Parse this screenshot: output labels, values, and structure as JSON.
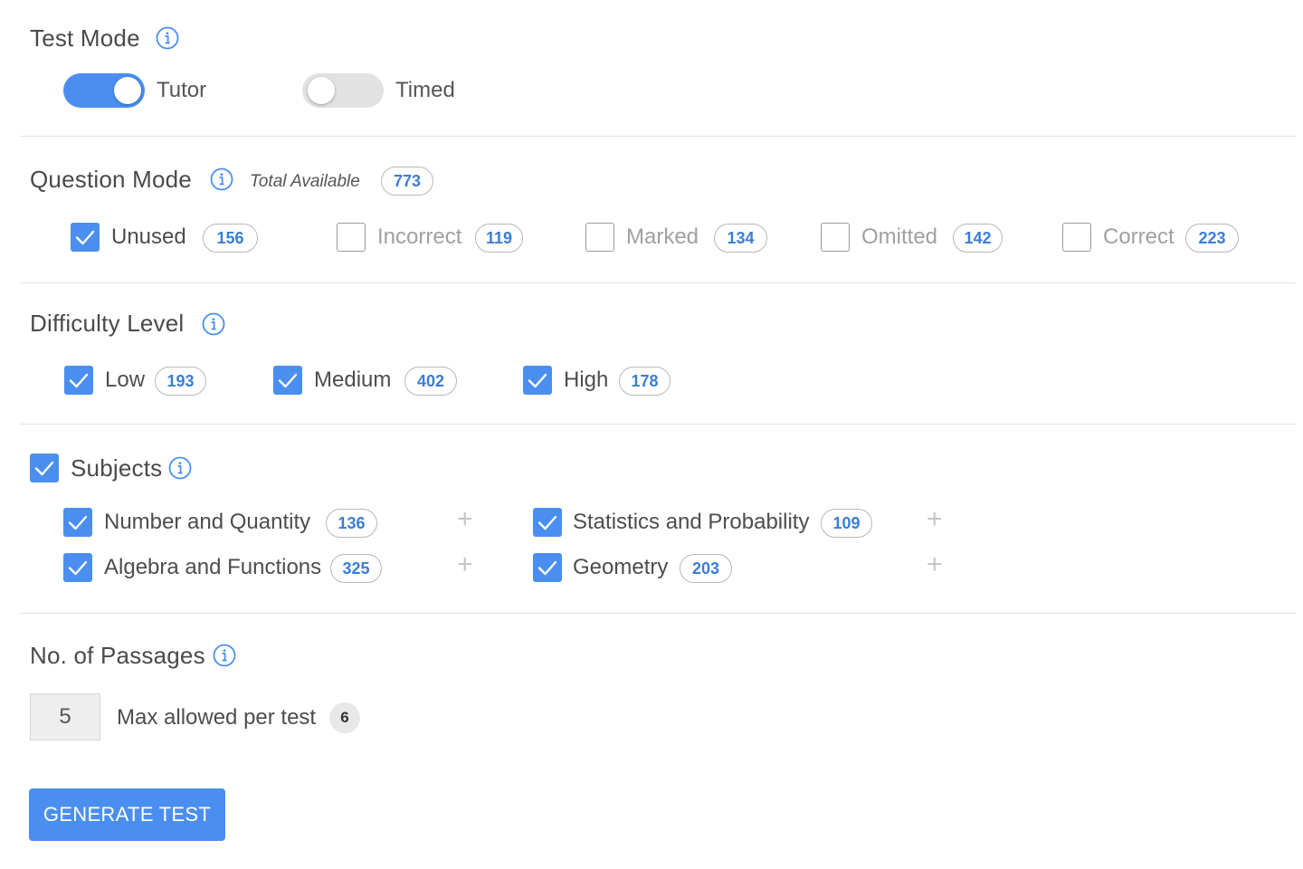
{
  "colors": {
    "accent": "#4a8ff0",
    "pill_text": "#3c7dd6",
    "muted_text": "#a0a0a0"
  },
  "test_mode": {
    "title": "Test Mode",
    "info_icon": "info-circle-icon",
    "tutor": {
      "label": "Tutor",
      "on": true
    },
    "timed": {
      "label": "Timed",
      "on": false
    }
  },
  "question_mode": {
    "title": "Question Mode",
    "info_icon": "info-circle-icon",
    "total_label": "Total Available",
    "total": "773",
    "options": [
      {
        "label": "Unused",
        "count": "156",
        "checked": true
      },
      {
        "label": "Incorrect",
        "count": "119",
        "checked": false
      },
      {
        "label": "Marked",
        "count": "134",
        "checked": false
      },
      {
        "label": "Omitted",
        "count": "142",
        "checked": false
      },
      {
        "label": "Correct",
        "count": "223",
        "checked": false
      }
    ]
  },
  "difficulty": {
    "title": "Difficulty Level",
    "info_icon": "info-circle-icon",
    "options": [
      {
        "label": "Low",
        "count": "193",
        "checked": true
      },
      {
        "label": "Medium",
        "count": "402",
        "checked": true
      },
      {
        "label": "High",
        "count": "178",
        "checked": true
      }
    ]
  },
  "subjects": {
    "title": "Subjects",
    "checked": true,
    "info_icon": "info-circle-icon",
    "items": [
      {
        "label": "Number and Quantity",
        "count": "136",
        "checked": true
      },
      {
        "label": "Statistics and Probability",
        "count": "109",
        "checked": true
      },
      {
        "label": "Algebra and Functions",
        "count": "325",
        "checked": true
      },
      {
        "label": "Geometry",
        "count": "203",
        "checked": true
      }
    ],
    "expand_icon": "plus-icon"
  },
  "passages": {
    "title": "No. of Passages",
    "info_icon": "info-circle-icon",
    "value": "5",
    "max_label": "Max allowed per test",
    "max_value": "6"
  },
  "generate_button": {
    "label": "GENERATE TEST"
  }
}
